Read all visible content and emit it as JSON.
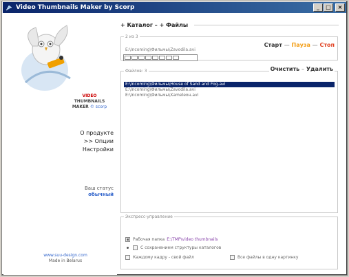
{
  "window": {
    "title": "Video Thumbnails Maker by Scorp",
    "minimize": "_",
    "maximize": "□",
    "close": "×"
  },
  "brand": {
    "line1": "VIDEO",
    "line2": "THUMBNAILS",
    "line3": "MAKER",
    "by": "© scorp"
  },
  "menu": {
    "about": "О продукте",
    "options": ">> Опции",
    "settings": "Настройки"
  },
  "status": {
    "label": "Ваш статус",
    "value": "обычный"
  },
  "footer": {
    "site": "www.suu-design.com",
    "made": "Made in Belarus"
  },
  "tabs": {
    "catalog": "+ Каталог",
    "files": "+ Файлы"
  },
  "progress": {
    "legend": "2 из 3",
    "path": "E:\\Incoming\\Фильмы\\Zavodila.avi",
    "segments": 8,
    "filled": 0
  },
  "controls": {
    "start": "Старт",
    "pause": "Пауза",
    "stop": "Стоп"
  },
  "files": {
    "legend": "Файлов: 3",
    "clear": "Очистить",
    "delete": "Удалить",
    "items": [
      "E:\\Incoming\\Фильмы\\House of Sand and Fog.avi",
      "E:\\Incoming\\Фильмы\\Zavodila.avi",
      "E:\\Incoming\\Фильмы\\Xamelеон.avi"
    ],
    "selected_index": 0
  },
  "express": {
    "legend": "Экспресс-управление",
    "work_folder_label": "Рабочая папка",
    "work_folder_value": "E:\\TMP\\video thumbnails",
    "keep_structure": "С сохранением структуры каталогов",
    "each_frame": "Каждому кадру - свой файл",
    "all_files": "Все файлы в одну картинку"
  },
  "colors": {
    "titlebar": "#0a246a",
    "accent": "#3366cc",
    "pause": "#f39c12",
    "stop": "#e04020",
    "brand_red": "#cc0000"
  }
}
